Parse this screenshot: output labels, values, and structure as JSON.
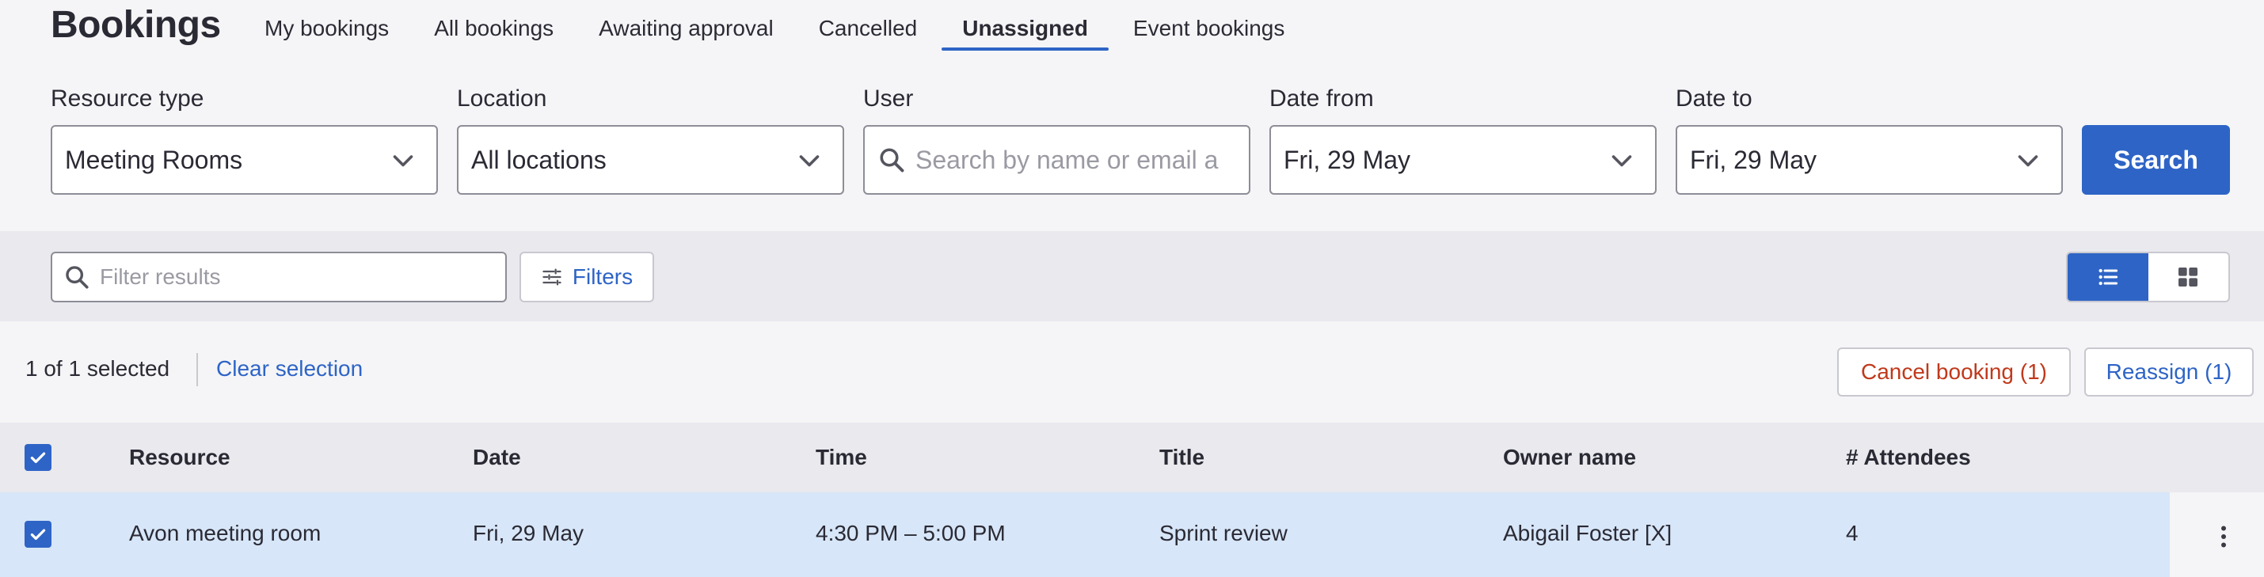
{
  "header": {
    "title": "Bookings",
    "tabs": [
      {
        "label": "My bookings",
        "active": false
      },
      {
        "label": "All bookings",
        "active": false
      },
      {
        "label": "Awaiting approval",
        "active": false
      },
      {
        "label": "Cancelled",
        "active": false
      },
      {
        "label": "Unassigned",
        "active": true
      },
      {
        "label": "Event bookings",
        "active": false
      }
    ]
  },
  "search_form": {
    "resource_type": {
      "label": "Resource type",
      "value": "Meeting Rooms"
    },
    "location": {
      "label": "Location",
      "value": "All locations"
    },
    "user": {
      "label": "User",
      "placeholder": "Search by name or email a"
    },
    "date_from": {
      "label": "Date from",
      "value": "Fri, 29 May"
    },
    "date_to": {
      "label": "Date to",
      "value": "Fri, 29 May"
    },
    "search_label": "Search"
  },
  "filterbar": {
    "filter_placeholder": "Filter results",
    "filters_label": "Filters",
    "view_mode": "list"
  },
  "selection": {
    "count_text": "1 of 1 selected",
    "clear_label": "Clear selection",
    "cancel_label": "Cancel booking (1)",
    "reassign_label": "Reassign (1)"
  },
  "table": {
    "columns": [
      "Resource",
      "Date",
      "Time",
      "Title",
      "Owner name",
      "# Attendees"
    ],
    "rows": [
      {
        "selected": true,
        "resource": "Avon meeting room",
        "date": "Fri, 29 May",
        "time": "4:30 PM – 5:00 PM",
        "title": "Sprint review",
        "owner": "Abigail Foster [X]",
        "attendees": "4"
      }
    ]
  },
  "colors": {
    "accent": "#2e64c6",
    "danger": "#c0391b",
    "selected_row": "#d7e6f8"
  }
}
